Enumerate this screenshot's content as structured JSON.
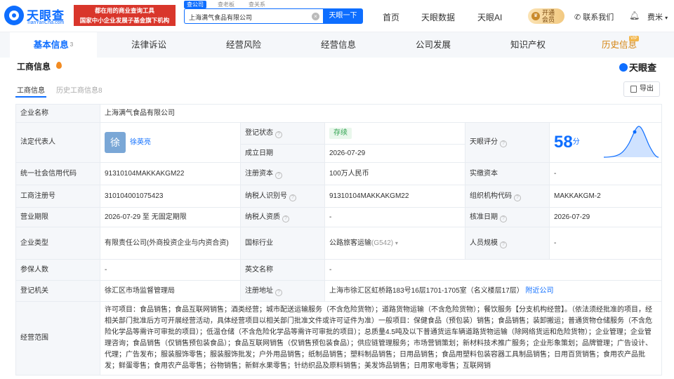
{
  "header": {
    "logo_name": "天眼查",
    "logo_domain": "TianYanCha.com",
    "promo_line1": "都在用的商业查询工具",
    "promo_line2": "国家中小企业发展子基金旗下机构",
    "search_tabs": [
      "查公司",
      "查老板",
      "查关系"
    ],
    "search_value": "上海满气食品有限公司",
    "search_button": "天眼一下",
    "nav": [
      "首页",
      "天眼数据",
      "天眼AI"
    ],
    "vip_line1": "开通",
    "vip_line2": "会员",
    "contact": "联系我们",
    "user": "费米"
  },
  "tabs": [
    {
      "label": "基本信息",
      "count": "3"
    },
    {
      "label": "法律诉讼"
    },
    {
      "label": "经营风险"
    },
    {
      "label": "经营信息"
    },
    {
      "label": "公司发展"
    },
    {
      "label": "知识产权"
    },
    {
      "label": "历史信息",
      "tag": "VIP"
    }
  ],
  "section": {
    "title": "工商信息",
    "brand": "天眼查",
    "sub_tabs": [
      "工商信息",
      "历史工商信息"
    ],
    "sub_tab_count": "8",
    "export": "导出"
  },
  "table": {
    "company_name_label": "企业名称",
    "company_name": "上海满气食品有限公司",
    "legal_rep_label": "法定代表人",
    "legal_rep_avatar": "徐",
    "legal_rep": "徐英亮",
    "reg_status_label": "登记状态",
    "reg_status": "存续",
    "founded_label": "成立日期",
    "founded": "2026-07-29",
    "score_label": "天眼评分",
    "score": "58",
    "score_unit": "分",
    "credit_code_label": "统一社会信用代码",
    "credit_code": "91310104MAKKAKGM22",
    "reg_capital_label": "注册资本",
    "reg_capital": "100万人民币",
    "paid_capital_label": "实缴资本",
    "paid_capital": "-",
    "reg_no_label": "工商注册号",
    "reg_no": "310104001075423",
    "taxpayer_id_label": "纳税人识别号",
    "taxpayer_id": "91310104MAKKAKGM22",
    "org_code_label": "组织机构代码",
    "org_code": "MAKKAKGM-2",
    "term_label": "营业期限",
    "term": "2026-07-29 至 无固定期限",
    "taxpayer_qual_label": "纳税人资质",
    "taxpayer_qual": "-",
    "approve_date_label": "核准日期",
    "approve_date": "2026-07-29",
    "type_label": "企业类型",
    "type": "有限责任公司(外商投资企业与内资合资)",
    "industry_label": "国标行业",
    "industry": "公路旅客运输",
    "industry_code": "(G542)",
    "staff_label": "人员规模",
    "staff": "-",
    "insured_label": "参保人数",
    "insured": "-",
    "english_label": "英文名称",
    "english": "-",
    "authority_label": "登记机关",
    "authority": "徐汇区市场监督管理局",
    "address_label": "注册地址",
    "address": "上海市徐汇区虹桥路183号16层1701-1705室（名义楼层17层）",
    "nearby": "附近公司",
    "scope_label": "经营范围",
    "scope": "许可项目：食品销售；食品互联网销售；酒类经营；城市配送运输服务（不含危险货物）；道路货物运输（不含危险货物）；餐饮服务【分支机构经营】。（依法须经批准的项目，经相关部门批准后方可开展经营活动，具体经营项目以相关部门批准文件或许可证件为准）一般项目：保健食品（预包装）销售；食品销售；装卸搬运；普通货物仓储服务（不含危险化学品等需许可审批的项目）；低温仓储（不含危险化学品等需许可审批的项目）；总质量4.5吨及以下普通货运车辆道路货物运输（除网络货运和危险货物）；企业管理；企业管理咨询；食品销售（仅销售预包装食品）；食品互联网销售（仅销售预包装食品）；供应链管理服务；市场营销策划；新材料技术推广服务；企业形象策划；品牌管理；广告设计、代理；广告发布；服装服饰零售；服装服饰批发；户外用品销售；纸制品销售；塑料制品销售；日用品销售；食品用塑料包装容器工具制品销售；日用百货销售；食用农产品批发；鲜蛋零售；食用农产品零售；谷物销售；新鲜水果零售；针纺织品及原料销售；美发饰品销售；日用家电零售；互联网销"
  },
  "colors": {
    "brand": "#0e6eff",
    "promo": "#d9362b",
    "history": "#d58512",
    "status": "#31a350"
  }
}
